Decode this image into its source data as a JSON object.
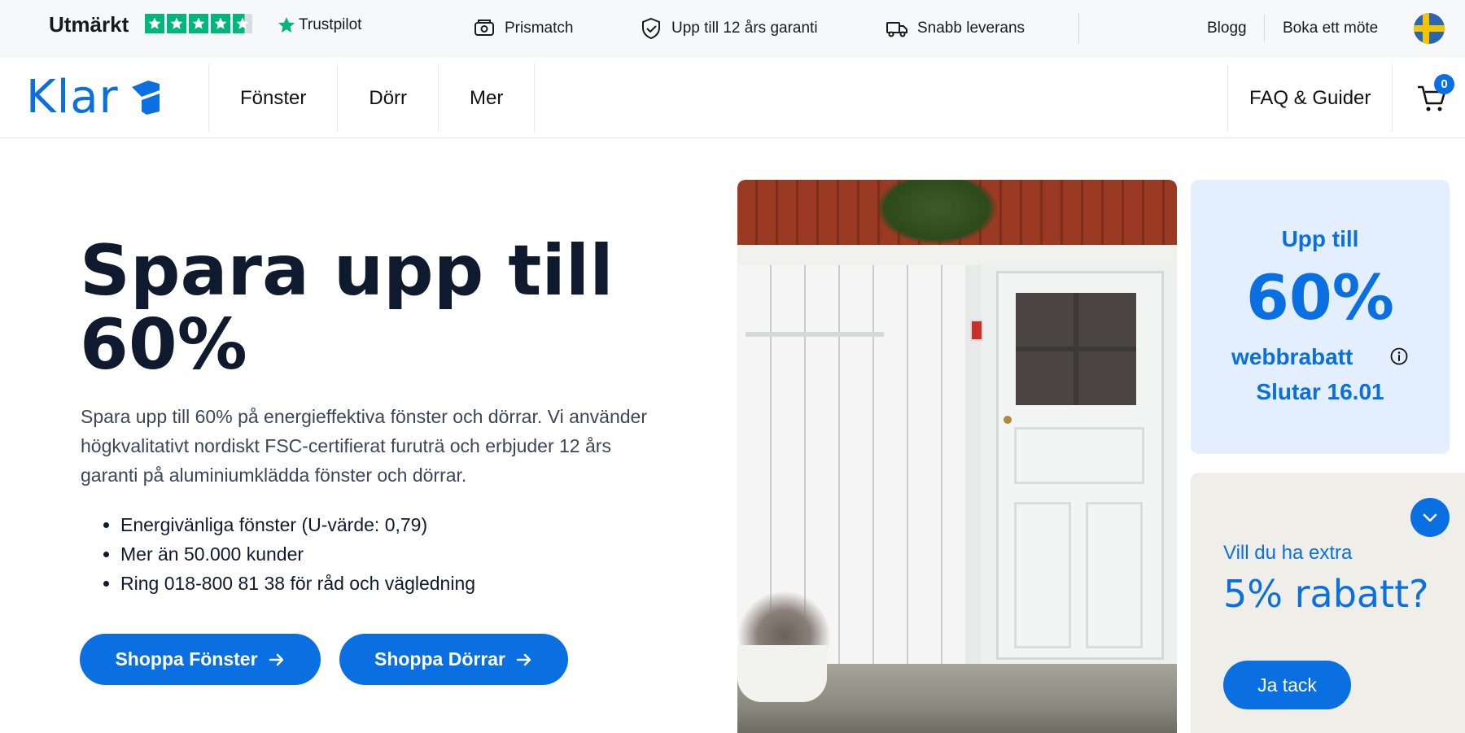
{
  "topbar": {
    "rating_label": "Utmärkt",
    "trustpilot_label": "Trustpilot",
    "usps": [
      {
        "label": "Prismatch",
        "icon": "price-match-icon"
      },
      {
        "label": "Upp till 12 års garanti",
        "icon": "shield-check-icon"
      },
      {
        "label": "Snabb leverans",
        "icon": "truck-icon"
      }
    ],
    "links": [
      "Blogg",
      "Boka ett möte"
    ],
    "language_flag": "sweden-flag-icon"
  },
  "header": {
    "logo_text": "Klar",
    "nav": [
      "Fönster",
      "Dörr",
      "Mer"
    ],
    "faq_label": "FAQ & Guider",
    "cart_count": "0"
  },
  "hero": {
    "title": "Spara upp till 60%",
    "description": "Spara upp till 60% på energieffektiva fönster och dörrar. Vi använder högkvalitativt nordiskt FSC-certifierat furuträ och erbjuder 12 års garanti på aluminiumklädda fönster och dörrar.",
    "bullets": [
      "Energivänliga fönster (U-värde: 0,79)",
      "Mer än 50.000 kunder",
      "Ring 018-800 81 38 för råd och vägledning"
    ],
    "buttons": [
      "Shoppa Fönster",
      "Shoppa Dörrar"
    ]
  },
  "promo": {
    "line1": "Upp till",
    "line2": "60%",
    "line3": "webbrabatt",
    "line4": "Slutar 16.01"
  },
  "extra_discount": {
    "question": "Vill du ha extra",
    "headline": "5% rabatt?",
    "button": "Ja tack"
  },
  "colors": {
    "accent": "#0a6fe0",
    "trustpilot_green": "#00b67a",
    "promo_bg": "#e3efff",
    "popup_bg": "#efeee9"
  }
}
